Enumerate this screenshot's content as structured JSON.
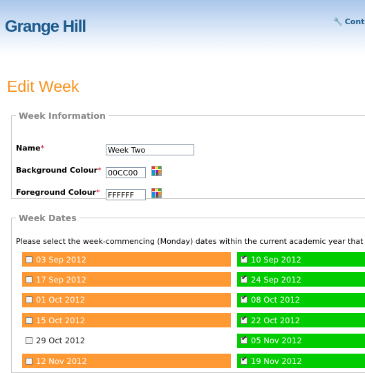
{
  "header": {
    "logo": "Grange Hill",
    "contact_label": "Cont"
  },
  "page": {
    "title": "Edit Week"
  },
  "week_info": {
    "legend": "Week Information",
    "name_label": "Name",
    "name_value": "Week Two",
    "bg_label": "Background Colour",
    "bg_value": "00CC00",
    "fg_label": "Foreground Colour",
    "fg_value": "FFFFFF",
    "required_mark": "*"
  },
  "week_dates": {
    "legend": "Week Dates",
    "intro": "Please select the week-commencing (Monday) dates within the current academic year that",
    "rows": [
      {
        "left": {
          "date": "03 Sep 2012",
          "checked": false,
          "state": "orange"
        },
        "right": {
          "date": "10 Sep 2012",
          "checked": true,
          "state": "green"
        }
      },
      {
        "left": {
          "date": "17 Sep 2012",
          "checked": false,
          "state": "orange"
        },
        "right": {
          "date": "24 Sep 2012",
          "checked": true,
          "state": "green"
        }
      },
      {
        "left": {
          "date": "01 Oct 2012",
          "checked": false,
          "state": "orange"
        },
        "right": {
          "date": "08 Oct 2012",
          "checked": true,
          "state": "green"
        }
      },
      {
        "left": {
          "date": "15 Oct 2012",
          "checked": false,
          "state": "orange"
        },
        "right": {
          "date": "22 Oct 2012",
          "checked": true,
          "state": "green"
        }
      },
      {
        "left": {
          "date": "29 Oct 2012",
          "checked": false,
          "state": "plain"
        },
        "right": {
          "date": "05 Nov 2012",
          "checked": true,
          "state": "green"
        }
      },
      {
        "left": {
          "date": "12 Nov 2012",
          "checked": false,
          "state": "orange"
        },
        "right": {
          "date": "19 Nov 2012",
          "checked": true,
          "state": "green"
        }
      }
    ]
  },
  "colors": {
    "brand": "#1c5a8c",
    "title_orange": "#f7931e",
    "other_week": "#ff9933",
    "this_week": "#00cc00"
  }
}
